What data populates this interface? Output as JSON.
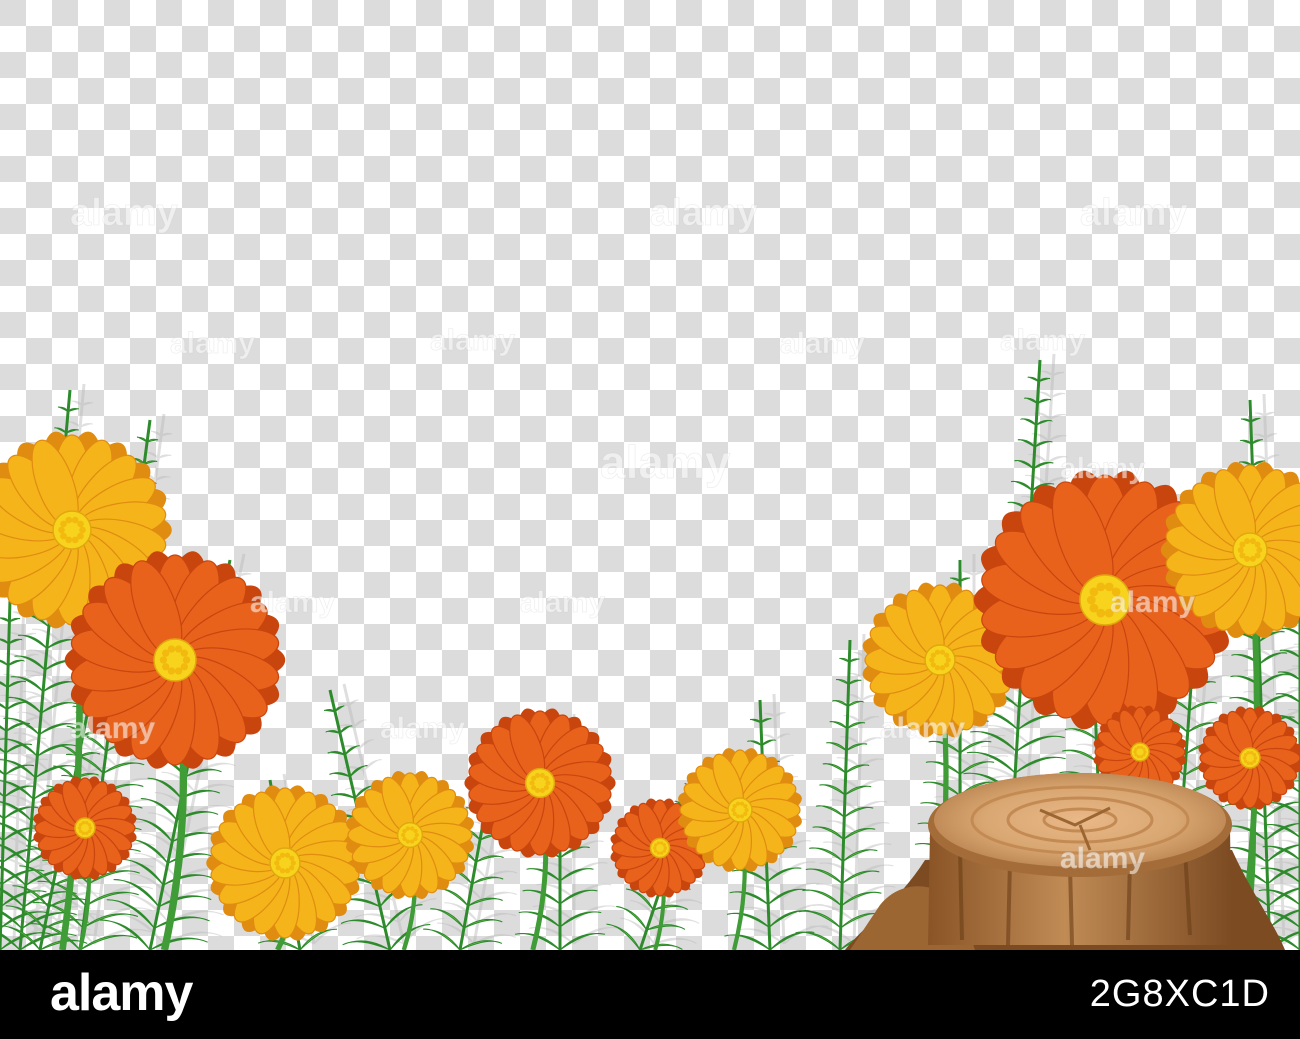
{
  "image": {
    "subject": "flower-and-fern-frame-on-transparent-checkerboard",
    "background": {
      "pattern": "checkerboard",
      "light_color": "#ffffff",
      "dark_color": "#dcdcdc"
    },
    "colors": {
      "fern_dark": "#2e8b2c",
      "fern_light": "#6cc24a",
      "fern_shadow": "#b9b9b9",
      "orange_petal": "#e8621c",
      "orange_petal_dark": "#c9450e",
      "yellow_petal": "#f5b41a",
      "yellow_petal_dark": "#e08c10",
      "flower_center": "#f7d31e",
      "stump_top": "#d9a772",
      "stump_bark": "#b07a46",
      "stump_dark": "#7c4b22"
    }
  },
  "watermark": {
    "text": "alamy",
    "repeat_text": "alamy"
  },
  "footer": {
    "logo_text": "alamy",
    "image_id": "2G8XC1D",
    "background": "#000000",
    "text_color": "#ffffff"
  }
}
